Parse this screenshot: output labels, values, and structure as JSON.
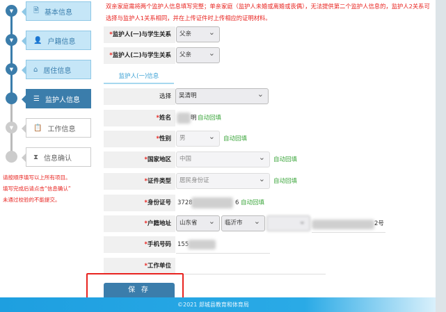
{
  "sidebar": {
    "steps": [
      {
        "label": "基本信息",
        "icon": "document-icon",
        "state": "done"
      },
      {
        "label": "户籍信息",
        "icon": "person-icon",
        "state": "done"
      },
      {
        "label": "居住信息",
        "icon": "home-icon",
        "state": "done"
      },
      {
        "label": "监护人信息",
        "icon": "guardian-icon",
        "state": "active"
      },
      {
        "label": "工作信息",
        "icon": "clipboard-icon",
        "state": "todo"
      },
      {
        "label": "信息确认",
        "icon": "hourglass-icon",
        "state": "todo"
      }
    ],
    "notes": [
      "请按顺序填写以上所有项目。",
      "填写完成后请点击“信息确认”",
      "未通过校验的不能提交。"
    ]
  },
  "warning": "双亲家庭需将两个监护人信息填写完整；单亲家庭（监护人未婚或离婚或丧偶），无法提供第二个监护人信息的，监护人2关系可选择与监护人1关系相同，并在上传证件时上传相应的证明材料。",
  "relations": [
    {
      "label": "监护人(一)与学生关系",
      "value": "父亲"
    },
    {
      "label": "监护人(二)与学生关系",
      "value": "父亲"
    }
  ],
  "tab": "监护人(一)信息",
  "form": {
    "select": {
      "label": "选择",
      "value": "吴清明"
    },
    "name": {
      "label": "姓名",
      "value_visible": "明",
      "auto": "自动回填"
    },
    "gender": {
      "label": "性别",
      "value": "男",
      "auto": "自动回填"
    },
    "country": {
      "label": "国家地区",
      "value": "中国",
      "auto": "自动回填"
    },
    "id_type": {
      "label": "证件类型",
      "value": "居民身份证",
      "auto": "自动回填"
    },
    "id_no": {
      "label": "身份证号",
      "prefix": "3728",
      "suffix": "6",
      "auto": "自动回填"
    },
    "address": {
      "label": "户籍地址",
      "province": "山东省",
      "city": "临沂市",
      "suffix": "2号"
    },
    "phone": {
      "label": "手机号码",
      "prefix": "155"
    },
    "work": {
      "label": "工作单位"
    }
  },
  "save": "保 存",
  "footer": "©2021  郯城县教育和体育局",
  "colors": {
    "accent": "#3b7dab",
    "warning": "#e8231f",
    "auto": "#3aa53a"
  }
}
